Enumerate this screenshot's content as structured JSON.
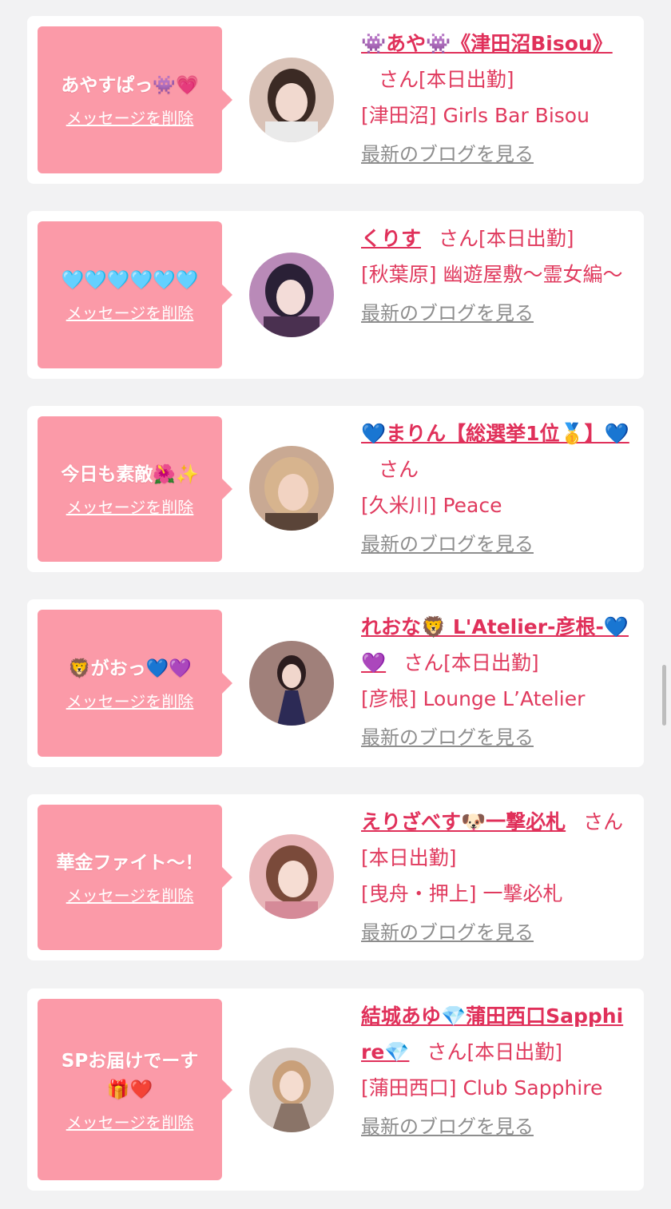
{
  "delete_label": "メッセージを削除",
  "san_label": "さん",
  "blog_label": "最新のブログを見る",
  "accent": "#e0305a",
  "bubble_color": "#fb9aa8",
  "items": [
    {
      "message": "あやすぱっ👾💗",
      "cast_name": "👾あや👾《津田沼Bisou》",
      "attendance": "[本日出勤]",
      "shop": "[津田沼] Girls Bar Bisou",
      "avatar_tone": [
        "#d9c2b7",
        "#3b2a24"
      ]
    },
    {
      "message": "🩵🩵🩵🩵🩵🩵",
      "cast_name": "くりす",
      "attendance": "[本日出勤]",
      "shop": "[秋葉原] 幽遊屋敷〜霊女編〜",
      "avatar_tone": [
        "#b98ab8",
        "#2a2036"
      ]
    },
    {
      "message": "今日も素敵🌺✨",
      "cast_name": "💙まりん【総選挙1位🥇】💙",
      "attendance": "",
      "shop": "[久米川] Peace",
      "avatar_tone": [
        "#c9a993",
        "#5a4438"
      ]
    },
    {
      "message": "🦁がおっ💙💜",
      "cast_name": "れおな🦁 L'Atelier-彦根-💙💜",
      "attendance": "[本日出勤]",
      "shop": "[彦根] Lounge L’Atelier",
      "avatar_tone": [
        "#a0807a",
        "#2b1c1e"
      ]
    },
    {
      "message": "華金ファイト〜！",
      "cast_name": "えりざべす🐶一撃必札",
      "attendance": "[本日出勤]",
      "shop": "[曳舟・押上] 一撃必札",
      "avatar_tone": [
        "#e8b5b8",
        "#7a4a3a"
      ]
    },
    {
      "message": "SPお届けでーす\n🎁❤️",
      "cast_name": "結城あゆ💎蒲田西口Sapphire💎",
      "attendance": "[本日出勤]",
      "shop": "[蒲田西口] Club Sapphire",
      "avatar_tone": [
        "#d8cbc4",
        "#8a7468"
      ]
    }
  ]
}
